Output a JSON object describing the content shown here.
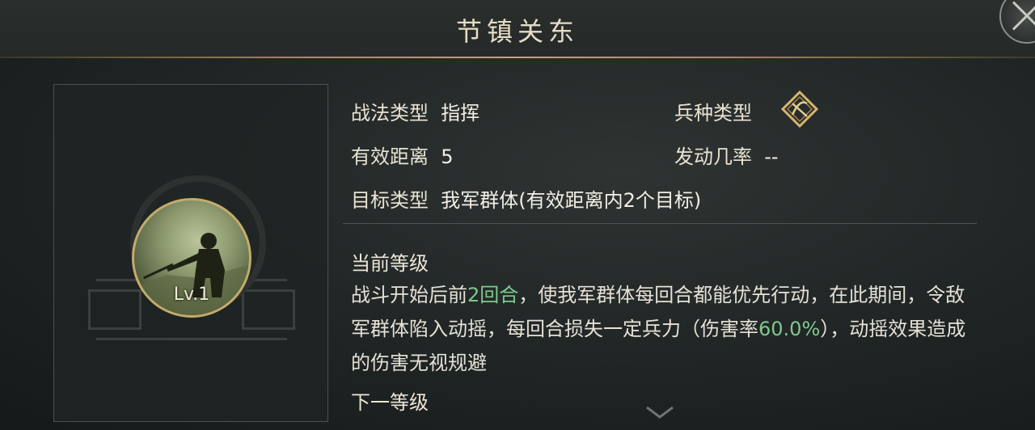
{
  "title": "节镇关东",
  "level_label": "Lv.1",
  "attributes": {
    "tactic_type_label": "战法类型",
    "tactic_type_value": "指挥",
    "troop_type_label": "兵种类型",
    "range_label": "有效距离",
    "range_value": "5",
    "trigger_rate_label": "发动几率",
    "trigger_rate_value": "--",
    "target_label": "目标类型",
    "target_value": "我军群体(有效距离内2个目标)"
  },
  "current_level": {
    "title": "当前等级",
    "desc_part1": "战斗开始后前",
    "desc_hl1": "2回合",
    "desc_part2": "，使我军群体每回合都能优先行动，在此期间，令敌军群体陷入动摇，每回合损失一定兵力（伤害率",
    "desc_hl2": "60.0%",
    "desc_part3": "），动摇效果造成的伤害无视规避"
  },
  "next_level": {
    "title": "下一等级"
  },
  "icons": {
    "close": "close-icon",
    "troop_type": "crossbow-icon",
    "scroll": "chevron-down-icon"
  },
  "colors": {
    "accent_gold": "#c5ab6a",
    "highlight_green": "#7fc98e"
  }
}
